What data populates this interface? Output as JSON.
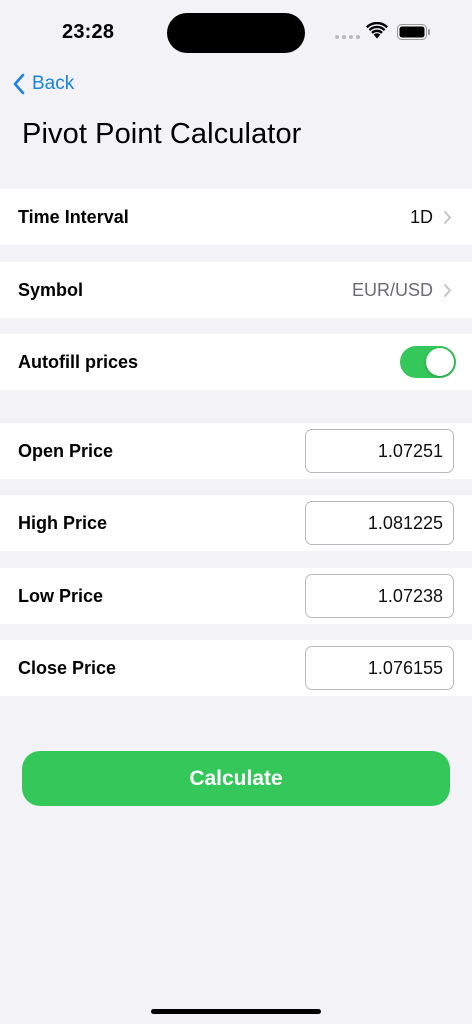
{
  "status_bar": {
    "time": "23:28"
  },
  "nav": {
    "back_label": "Back",
    "title": "Pivot Point Calculator"
  },
  "settings": {
    "time_interval": {
      "label": "Time Interval",
      "value": "1D"
    },
    "symbol": {
      "label": "Symbol",
      "value": "EUR/USD"
    },
    "autofill": {
      "label": "Autofill prices",
      "enabled": true
    }
  },
  "prices": {
    "open": {
      "label": "Open Price",
      "value": "1.07251"
    },
    "high": {
      "label": "High Price",
      "value": "1.081225"
    },
    "low": {
      "label": "Low Price",
      "value": "1.07238"
    },
    "close": {
      "label": "Close Price",
      "value": "1.076155"
    }
  },
  "actions": {
    "calculate_label": "Calculate"
  },
  "colors": {
    "accent": "#1a82e2",
    "green": "#34c759",
    "background": "#f2f2f7"
  }
}
